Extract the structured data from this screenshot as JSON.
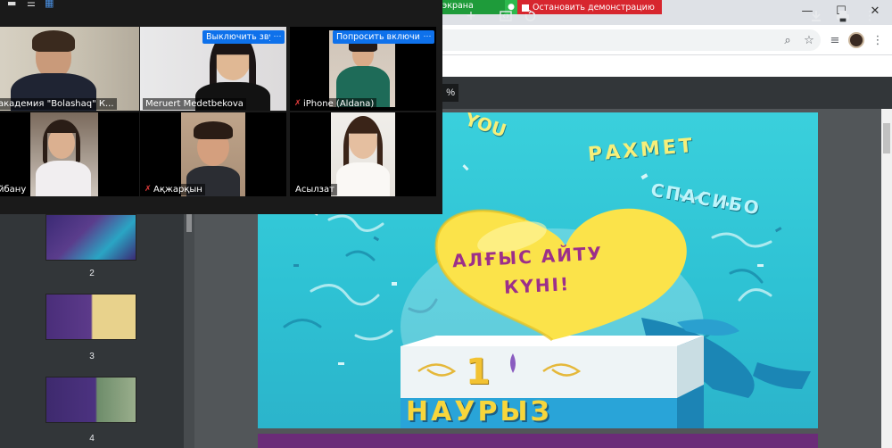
{
  "share_bar": {
    "sharing_label": "экрана",
    "stop_label": "Остановить демонстрацию"
  },
  "chrome": {
    "window_controls": [
      "—",
      "☐",
      "✕"
    ]
  },
  "pdf_toolbar": {
    "zoom_value": "%",
    "icons": [
      "zoom-in-icon",
      "fit-page-icon",
      "rotate-icon",
      "download-icon",
      "print-icon",
      "more-icon"
    ]
  },
  "sidebar": {
    "pages": [
      {
        "number": "2"
      },
      {
        "number": "3"
      },
      {
        "number": "4"
      }
    ]
  },
  "slide": {
    "words": {
      "you": "YOU",
      "rakhmet": "РАХМЕТ",
      "spasibo": "СПАСИБО",
      "heart_line1": "АЛҒЫС АЙТУ",
      "heart_line2": "КҮНІ!",
      "date_number": "1",
      "month": "НАУРЫЗ"
    }
  },
  "zoom": {
    "participants": [
      {
        "name": "академия \"Bolashaq\" К...",
        "muted": false
      },
      {
        "name": "Meruert Medetbekova",
        "muted": false,
        "button": "Выключить звук"
      },
      {
        "name": "iPhone (Aldana)",
        "muted": true,
        "button": "Попросить включить"
      },
      {
        "name": "йбану",
        "muted": false
      },
      {
        "name": "Ақжарқын",
        "muted": true
      },
      {
        "name": "Асылзат",
        "muted": false
      }
    ],
    "more_label": "···"
  },
  "colors": {
    "share_green": "#1e9b3a",
    "share_red": "#d7262e",
    "zoom_blue": "#0e71eb",
    "active_speaker": "#c5d43c",
    "slide_bg": "#33c8d8",
    "slide_text": "#f6ef7a"
  }
}
